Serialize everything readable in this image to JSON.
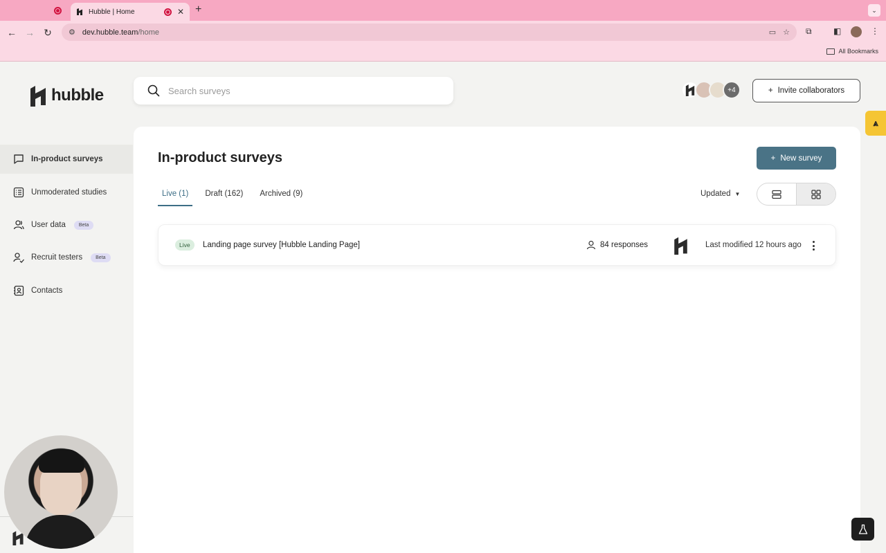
{
  "browser": {
    "tab_title": "Hubble | Home",
    "url_host": "dev.hubble.team",
    "url_path": "/home",
    "bookmarks_label": "All Bookmarks"
  },
  "app": {
    "logo_text": "hubble",
    "search": {
      "placeholder": "Search surveys"
    },
    "collaborators": {
      "more_count": "+4"
    },
    "invite_label": "Invite collaborators"
  },
  "sidebar": {
    "items": [
      {
        "label": "In-product surveys",
        "icon": "message-square-icon",
        "active": true
      },
      {
        "label": "Unmoderated studies",
        "icon": "list-icon"
      },
      {
        "label": "User data",
        "icon": "users-icon",
        "badge": "Beta"
      },
      {
        "label": "Recruit testers",
        "icon": "user-check-icon",
        "badge": "Beta"
      },
      {
        "label": "Contacts",
        "icon": "contact-card-icon"
      }
    ]
  },
  "main": {
    "title": "In-product surveys",
    "new_survey_label": "New survey",
    "tabs": [
      {
        "label": "Live (1)",
        "active": true
      },
      {
        "label": "Draft (162)"
      },
      {
        "label": "Archived (9)"
      }
    ],
    "sort_label": "Updated",
    "surveys": [
      {
        "status": "Live",
        "title": "Landing page survey [Hubble Landing Page]",
        "responses": "84 responses",
        "modified": "Last modified 12 hours ago"
      }
    ]
  },
  "colors": {
    "accent": "#4a7386",
    "tab_active": "#3d6e86",
    "chrome_pink": "#f7a8c2",
    "live_badge_bg": "#dbeedf",
    "beta_badge_bg": "#dedcf4",
    "side_tab": "#f5c534"
  }
}
